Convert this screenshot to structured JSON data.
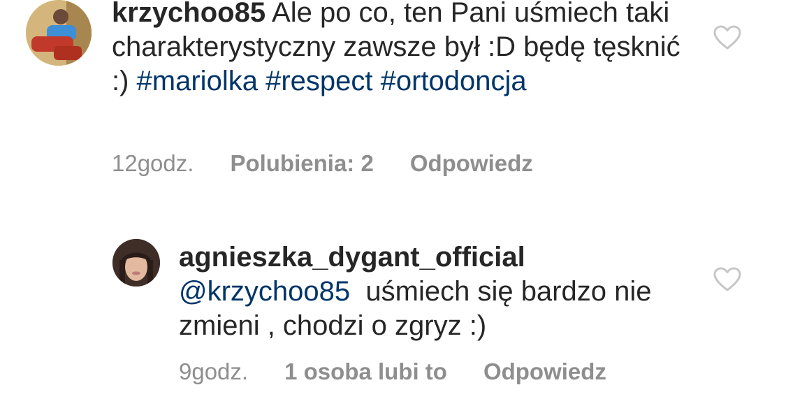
{
  "comments": [
    {
      "username": "krzychoo85",
      "text_parts": [
        "Ale po co, ten Pani uśmiech taki charakterystyczny zawsze był :D będę tęsknić :) ",
        "#mariolka",
        " ",
        "#respect",
        " ",
        "#ortodoncja"
      ],
      "time": "12godz.",
      "likes": "Polubienia: 2",
      "reply": "Odpowiedz",
      "avatar_icon": "user-avatar",
      "like_icon": "heart-outline-icon"
    },
    {
      "username": "agnieszka_dygant_official",
      "mention": "@krzychoo85",
      "text": "  uśmiech się bardzo nie zmieni , chodzi o zgryz :)",
      "time": "9godz.",
      "likes": "1 osoba lubi to",
      "reply": "Odpowiedz",
      "avatar_icon": "user-avatar",
      "like_icon": "heart-outline-icon"
    }
  ],
  "colors": {
    "text": "#262626",
    "link": "#003569",
    "meta": "#8e8e8e",
    "heart": "#c7c7c7"
  }
}
